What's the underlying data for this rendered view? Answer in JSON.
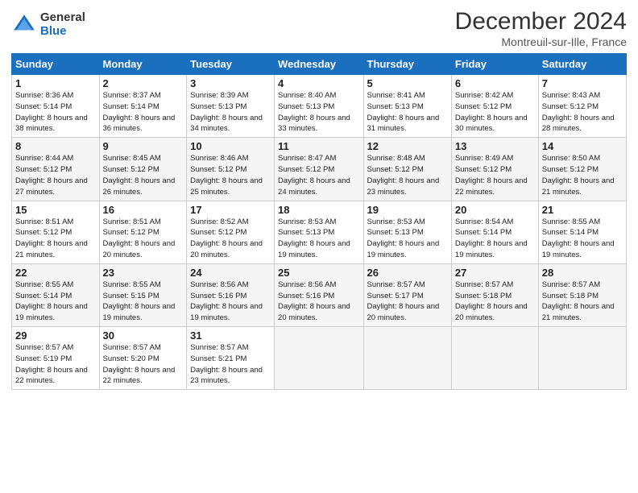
{
  "header": {
    "logo_general": "General",
    "logo_blue": "Blue",
    "title": "December 2024",
    "location": "Montreuil-sur-Ille, France"
  },
  "weekdays": [
    "Sunday",
    "Monday",
    "Tuesday",
    "Wednesday",
    "Thursday",
    "Friday",
    "Saturday"
  ],
  "weeks": [
    [
      {
        "day": 1,
        "sunrise": "8:36 AM",
        "sunset": "5:14 PM",
        "daylight": "8 hours and 38 minutes."
      },
      {
        "day": 2,
        "sunrise": "8:37 AM",
        "sunset": "5:14 PM",
        "daylight": "8 hours and 36 minutes."
      },
      {
        "day": 3,
        "sunrise": "8:39 AM",
        "sunset": "5:13 PM",
        "daylight": "8 hours and 34 minutes."
      },
      {
        "day": 4,
        "sunrise": "8:40 AM",
        "sunset": "5:13 PM",
        "daylight": "8 hours and 33 minutes."
      },
      {
        "day": 5,
        "sunrise": "8:41 AM",
        "sunset": "5:13 PM",
        "daylight": "8 hours and 31 minutes."
      },
      {
        "day": 6,
        "sunrise": "8:42 AM",
        "sunset": "5:12 PM",
        "daylight": "8 hours and 30 minutes."
      },
      {
        "day": 7,
        "sunrise": "8:43 AM",
        "sunset": "5:12 PM",
        "daylight": "8 hours and 28 minutes."
      }
    ],
    [
      {
        "day": 8,
        "sunrise": "8:44 AM",
        "sunset": "5:12 PM",
        "daylight": "8 hours and 27 minutes."
      },
      {
        "day": 9,
        "sunrise": "8:45 AM",
        "sunset": "5:12 PM",
        "daylight": "8 hours and 26 minutes."
      },
      {
        "day": 10,
        "sunrise": "8:46 AM",
        "sunset": "5:12 PM",
        "daylight": "8 hours and 25 minutes."
      },
      {
        "day": 11,
        "sunrise": "8:47 AM",
        "sunset": "5:12 PM",
        "daylight": "8 hours and 24 minutes."
      },
      {
        "day": 12,
        "sunrise": "8:48 AM",
        "sunset": "5:12 PM",
        "daylight": "8 hours and 23 minutes."
      },
      {
        "day": 13,
        "sunrise": "8:49 AM",
        "sunset": "5:12 PM",
        "daylight": "8 hours and 22 minutes."
      },
      {
        "day": 14,
        "sunrise": "8:50 AM",
        "sunset": "5:12 PM",
        "daylight": "8 hours and 21 minutes."
      }
    ],
    [
      {
        "day": 15,
        "sunrise": "8:51 AM",
        "sunset": "5:12 PM",
        "daylight": "8 hours and 21 minutes."
      },
      {
        "day": 16,
        "sunrise": "8:51 AM",
        "sunset": "5:12 PM",
        "daylight": "8 hours and 20 minutes."
      },
      {
        "day": 17,
        "sunrise": "8:52 AM",
        "sunset": "5:12 PM",
        "daylight": "8 hours and 20 minutes."
      },
      {
        "day": 18,
        "sunrise": "8:53 AM",
        "sunset": "5:13 PM",
        "daylight": "8 hours and 19 minutes."
      },
      {
        "day": 19,
        "sunrise": "8:53 AM",
        "sunset": "5:13 PM",
        "daylight": "8 hours and 19 minutes."
      },
      {
        "day": 20,
        "sunrise": "8:54 AM",
        "sunset": "5:14 PM",
        "daylight": "8 hours and 19 minutes."
      },
      {
        "day": 21,
        "sunrise": "8:55 AM",
        "sunset": "5:14 PM",
        "daylight": "8 hours and 19 minutes."
      }
    ],
    [
      {
        "day": 22,
        "sunrise": "8:55 AM",
        "sunset": "5:14 PM",
        "daylight": "8 hours and 19 minutes."
      },
      {
        "day": 23,
        "sunrise": "8:55 AM",
        "sunset": "5:15 PM",
        "daylight": "8 hours and 19 minutes."
      },
      {
        "day": 24,
        "sunrise": "8:56 AM",
        "sunset": "5:16 PM",
        "daylight": "8 hours and 19 minutes."
      },
      {
        "day": 25,
        "sunrise": "8:56 AM",
        "sunset": "5:16 PM",
        "daylight": "8 hours and 20 minutes."
      },
      {
        "day": 26,
        "sunrise": "8:57 AM",
        "sunset": "5:17 PM",
        "daylight": "8 hours and 20 minutes."
      },
      {
        "day": 27,
        "sunrise": "8:57 AM",
        "sunset": "5:18 PM",
        "daylight": "8 hours and 20 minutes."
      },
      {
        "day": 28,
        "sunrise": "8:57 AM",
        "sunset": "5:18 PM",
        "daylight": "8 hours and 21 minutes."
      }
    ],
    [
      {
        "day": 29,
        "sunrise": "8:57 AM",
        "sunset": "5:19 PM",
        "daylight": "8 hours and 22 minutes."
      },
      {
        "day": 30,
        "sunrise": "8:57 AM",
        "sunset": "5:20 PM",
        "daylight": "8 hours and 22 minutes."
      },
      {
        "day": 31,
        "sunrise": "8:57 AM",
        "sunset": "5:21 PM",
        "daylight": "8 hours and 23 minutes."
      },
      null,
      null,
      null,
      null
    ]
  ]
}
